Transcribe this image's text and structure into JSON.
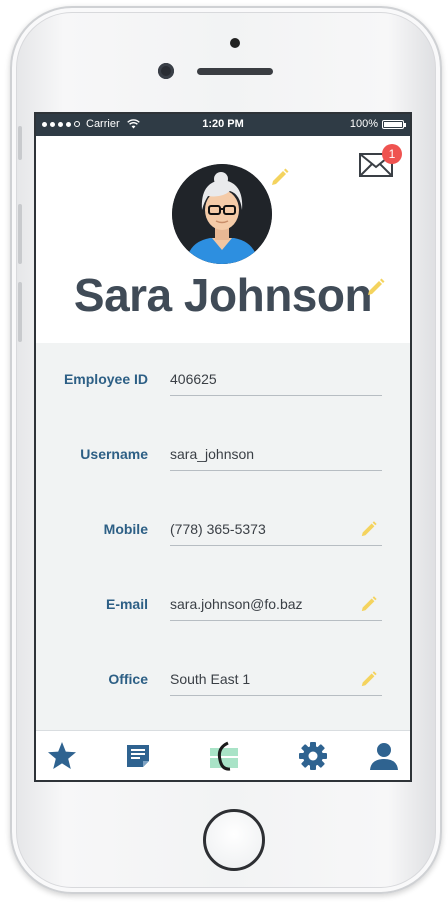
{
  "status_bar": {
    "signal_dots": 5,
    "carrier": "Carrier",
    "time": "1:20 PM",
    "battery_text": "100%",
    "battery_level": 1.0
  },
  "header": {
    "name": "Sara Johnson",
    "notification_count": "1",
    "icons": [
      "avatar",
      "pencil-icon",
      "mail-icon"
    ],
    "accent_pencil_color": "#f4d35e",
    "badge_color": "#ef5350"
  },
  "fields": [
    {
      "label": "Employee ID",
      "value": "406625",
      "editable": false
    },
    {
      "label": "Username",
      "value": "sara_johnson",
      "editable": false
    },
    {
      "label": "Mobile",
      "value": "(778) 365-5373",
      "editable": true
    },
    {
      "label": "E-mail",
      "value": "sara.johnson@fo.baz",
      "editable": true
    },
    {
      "label": "Office",
      "value": "South East 1",
      "editable": true
    }
  ],
  "tab_bar": {
    "tabs": [
      "star-icon",
      "notes-icon",
      "app-logo-icon",
      "gear-icon",
      "person-icon"
    ],
    "tab_color": "#2f6390"
  }
}
